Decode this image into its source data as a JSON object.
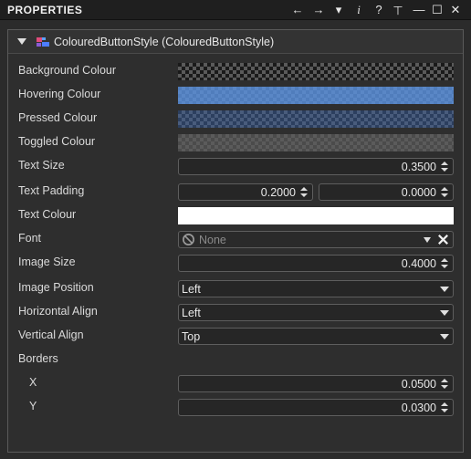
{
  "window": {
    "title": "PROPERTIES"
  },
  "toolbar": {
    "back": "←",
    "forward": "→",
    "menu": "▾",
    "info": "i",
    "help": "?",
    "pin": "⊥",
    "minimize": "—",
    "maximize": "☐",
    "close": "✕"
  },
  "component": {
    "title": "ColouredButtonStyle (ColouredButtonStyle)"
  },
  "labels": {
    "background_colour": "Background Colour",
    "hovering_colour": "Hovering Colour",
    "pressed_colour": "Pressed Colour",
    "toggled_colour": "Toggled Colour",
    "text_size": "Text Size",
    "text_padding": "Text Padding",
    "text_colour": "Text Colour",
    "font": "Font",
    "image_size": "Image Size",
    "image_position": "Image Position",
    "horizontal_align": "Horizontal Align",
    "vertical_align": "Vertical Align",
    "borders": "Borders",
    "border_x": "X",
    "border_y": "Y"
  },
  "values": {
    "text_size": "0.3500",
    "text_padding_1": "0.2000",
    "text_padding_2": "0.0000",
    "font": "None",
    "image_size": "0.4000",
    "image_position": "Left",
    "horizontal_align": "Left",
    "vertical_align": "Top",
    "border_x": "0.0500",
    "border_y": "0.0300"
  },
  "colors": {
    "background_colour": "transparent",
    "hovering_colour": "#5b8fd9",
    "pressed_colour": "#3d5f99",
    "toggled_colour": "#5c5c5c",
    "text_colour": "#ffffff"
  }
}
